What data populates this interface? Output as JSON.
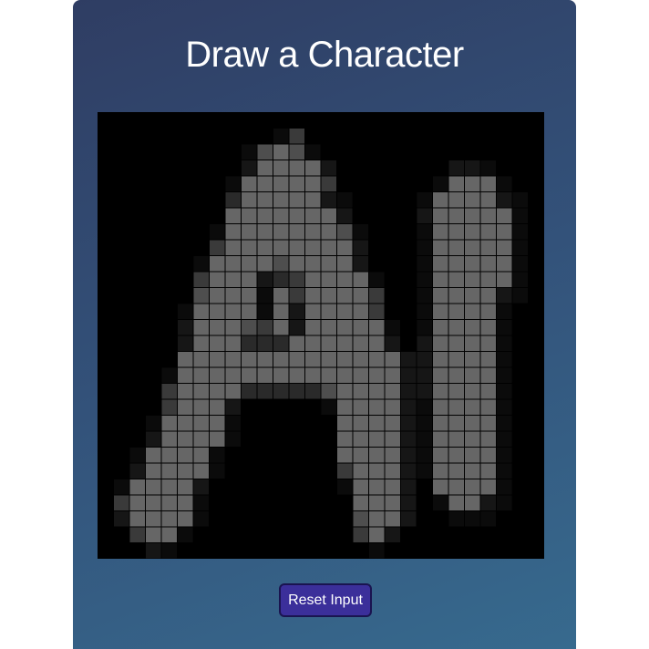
{
  "app": {
    "title": "Draw a Character"
  },
  "drawing_grid": {
    "columns": 28,
    "rows": 28,
    "cells": [
      "............................",
      "...........oa...............",
      ".........oqQqo..............",
      ".........bQQQQb.......bbo...",
      "........oQQQQQa......oQQQo..",
      "........mQQQQQbo....oQQQQbo.",
      "........QQQQQQQb....bQQQQQo.",
      ".......oQQQQQQQqo...oQQQQQo.",
      ".......aQQQQQQQQb...oQQQQQo.",
      "......oQQQQqQQQQb...oQQQQQo.",
      "......aQQQbmaQQQQo..oQQQQQo.",
      "......qQQQoQaQQQQa..oQQQQbo.",
      ".....oQQQQoQbQQQQa..oQQQQo..",
      ".....bQQQqaQbQQQQQo.oQQQQo..",
      ".....bQQQmmmQQQQQQb.bQQQQo..",
      ".....QQQQQQQQQQQQQQbbQQQQo..",
      "....oQQQQQQQQQQQQQQbbQQQQo..",
      "....aQQQQmmmmmqQQQQbbQQQQo..",
      "....aQQQb.....oQQQQboQQQQo..",
      "...oQQQQo......QQQQboQQQQo..",
      "...bQQQQo......QQQQboQQQQo..",
      "..oQQQQo.......QQQQboQQQQo..",
      "..bQQQQo.......aQQQboQQQQo..",
      ".oQQQQb........oQQQb.QQQQo..",
      ".aQQQQo.........QQQb.oQQbo..",
      ".bQQQQo.........qQQb..ooo...",
      "..aQQo..........aQb.........",
      "...bo............o.........."
    ],
    "shade_colors": {
      "o": "#0b0b0b",
      "b": "#161616",
      "m": "#2a2a2a",
      "a": "#3a3a3a",
      "q": "#4e4e4e",
      "Q": "#666666"
    },
    "grid_line_color": "#000000"
  },
  "controls": {
    "reset_label": "Reset Input"
  }
}
